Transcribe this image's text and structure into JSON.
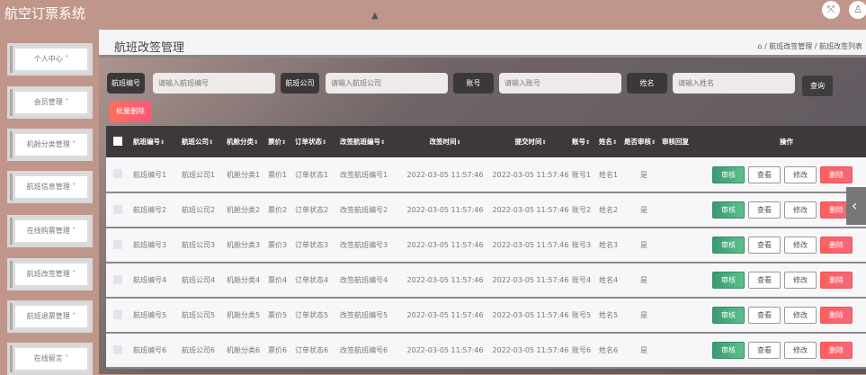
{
  "app": {
    "title": "航空订票系统"
  },
  "sidebar": {
    "items": [
      {
        "label": "个人中心"
      },
      {
        "label": "会员管理"
      },
      {
        "label": "机舱分类管理"
      },
      {
        "label": "航班信息管理"
      },
      {
        "label": "在线购票管理"
      },
      {
        "label": "航班改签管理"
      },
      {
        "label": "航班退票管理"
      },
      {
        "label": "在线留言"
      }
    ]
  },
  "page": {
    "title": "航班改签管理",
    "breadcrumb": [
      "航班改签管理",
      "航班改签列表"
    ]
  },
  "search": {
    "fields": [
      {
        "label": "航班编号",
        "placeholder": "请输入航班编号"
      },
      {
        "label": "航班公司",
        "placeholder": "请输入航班公司"
      },
      {
        "label": "账号",
        "placeholder": "请输入账号"
      },
      {
        "label": "姓名",
        "placeholder": "请输入姓名"
      }
    ],
    "query_label": "查询",
    "batch_delete_label": "批量删除"
  },
  "table": {
    "headers": [
      "航班编号",
      "航班公司",
      "机舱分类",
      "票价",
      "订单状态",
      "改签航班编号",
      "改签时间",
      "提交时间",
      "账号",
      "姓名",
      "是否审核",
      "审核回复",
      "操作"
    ],
    "actions": {
      "review": "审核",
      "view": "查看",
      "edit": "修改",
      "delete": "删除"
    },
    "rows": [
      [
        "航班编号1",
        "航班公司1",
        "机舱分类1",
        "票价1",
        "订单状态1",
        "改签航班编号1",
        "2022-03-05 11:57:46",
        "2022-03-05 11:57:46",
        "账号1",
        "姓名1",
        "是",
        ""
      ],
      [
        "航班编号2",
        "航班公司2",
        "机舱分类2",
        "票价2",
        "订单状态2",
        "改签航班编号2",
        "2022-03-05 11:57:46",
        "2022-03-05 11:57:46",
        "账号2",
        "姓名2",
        "是",
        ""
      ],
      [
        "航班编号3",
        "航班公司3",
        "机舱分类3",
        "票价3",
        "订单状态3",
        "改签航班编号3",
        "2022-03-05 11:57:46",
        "2022-03-05 11:57:46",
        "账号3",
        "姓名3",
        "是",
        ""
      ],
      [
        "航班编号4",
        "航班公司4",
        "机舱分类4",
        "票价4",
        "订单状态4",
        "改签航班编号4",
        "2022-03-05 11:57:46",
        "2022-03-05 11:57:46",
        "账号4",
        "姓名4",
        "是",
        ""
      ],
      [
        "航班编号5",
        "航班公司5",
        "机舱分类5",
        "票价5",
        "订单状态5",
        "改签航班编号5",
        "2022-03-05 11:57:46",
        "2022-03-05 11:57:46",
        "账号5",
        "姓名5",
        "是",
        ""
      ],
      [
        "航班编号6",
        "航班公司6",
        "机舱分类6",
        "票价6",
        "订单状态6",
        "改签航班编号6",
        "2022-03-05 11:57:46",
        "2022-03-05 11:57:46",
        "账号6",
        "姓名6",
        "是",
        ""
      ]
    ]
  }
}
